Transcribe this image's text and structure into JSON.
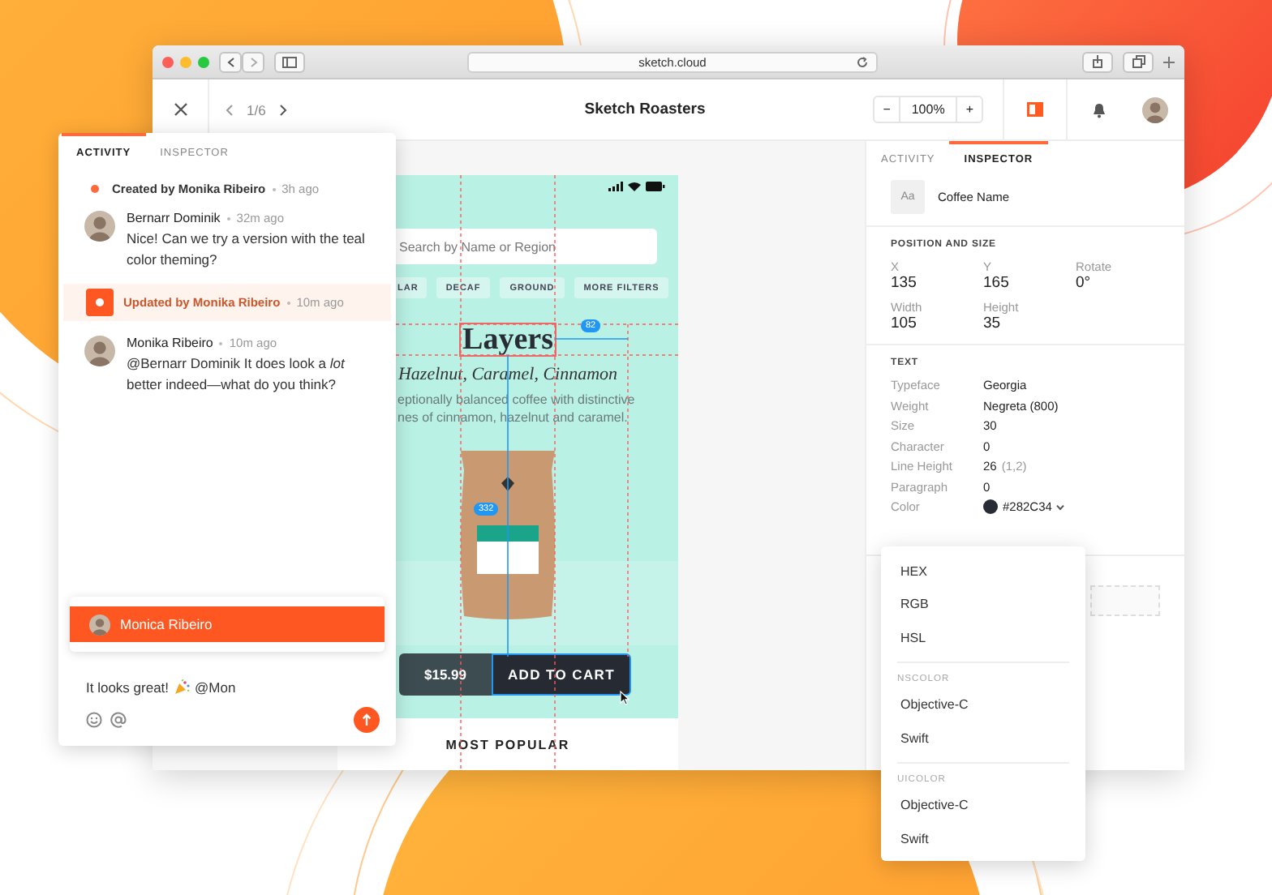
{
  "browser": {
    "url": "sketch.cloud"
  },
  "toolbar": {
    "page": "1/6",
    "title": "Sketch Roasters",
    "zoom_minus": "−",
    "zoom": "100%",
    "zoom_plus": "+"
  },
  "artboard": {
    "search": {
      "placeholder": "Search by Name or Region"
    },
    "filters": [
      "LAR",
      "DECAF",
      "GROUND",
      "MORE FILTERS"
    ],
    "title": "Layers",
    "subtitle": "Hazelnut, Caramel, Cinnamon",
    "description": [
      "eptionally balanced coffee with distinctive",
      "nes of cinnamon, hazelnut and caramel."
    ],
    "measurements": [
      "82",
      "332"
    ],
    "price": "$15.99",
    "cta": "ADD TO CART",
    "section": "MOST POPULAR"
  },
  "inspector": {
    "tabs": [
      {
        "label": "ACTIVITY",
        "selected": false
      },
      {
        "label": "INSPECTOR",
        "selected": true
      }
    ],
    "layer": {
      "icon": "Aa",
      "name": "Coffee Name"
    },
    "position": {
      "heading": "POSITION AND SIZE",
      "fields": [
        {
          "label": "X",
          "value": "135"
        },
        {
          "label": "Y",
          "value": "165"
        },
        {
          "label": "Rotate",
          "value": "0°"
        },
        {
          "label": "Width",
          "value": "105"
        },
        {
          "label": "Height",
          "value": "35"
        }
      ]
    },
    "text": {
      "heading": "TEXT",
      "rows": [
        {
          "label": "Typeface",
          "value": "Georgia"
        },
        {
          "label": "Weight",
          "value": "Negreta (800)"
        },
        {
          "label": "Size",
          "value": "30"
        },
        {
          "label": "Character",
          "value": "0"
        },
        {
          "label": "Line Height",
          "value": "26",
          "note": "(1,2)"
        },
        {
          "label": "Paragraph",
          "value": "0"
        },
        {
          "label": "Color",
          "value": "#282C34",
          "color": "#282c34"
        }
      ]
    }
  },
  "color_menu": {
    "sections": [
      {
        "items": [
          "HEX",
          "RGB",
          "HSL"
        ]
      },
      {
        "heading": "NSCOLOR",
        "items": [
          "Objective-C",
          "Swift"
        ]
      },
      {
        "heading": "UICOLOR",
        "items": [
          "Objective-C",
          "Swift"
        ]
      }
    ]
  },
  "activity": {
    "tabs": [
      {
        "label": "ACTIVITY",
        "selected": true
      },
      {
        "label": "INSPECTOR",
        "selected": false
      }
    ],
    "feed": [
      {
        "kind": "event",
        "text": "Created by Monika Ribeiro",
        "time": "3h ago"
      },
      {
        "kind": "comment",
        "author": "Bernarr Dominik",
        "time": "32m ago",
        "text": "Nice! Can we try a version with the teal color theming?"
      },
      {
        "kind": "update",
        "text": "Updated by Monika Ribeiro",
        "time": "10m ago"
      },
      {
        "kind": "comment",
        "author": "Monika Ribeiro",
        "time": "10m ago",
        "text": "@Bernarr Dominik It does look a *lot* better indeed—what do you think?"
      }
    ],
    "mention_suggestions": [
      {
        "name": "Monica Ribeiro",
        "selected": true
      }
    ],
    "composer": {
      "parts": [
        "It looks great!",
        "@Mon"
      ]
    }
  }
}
